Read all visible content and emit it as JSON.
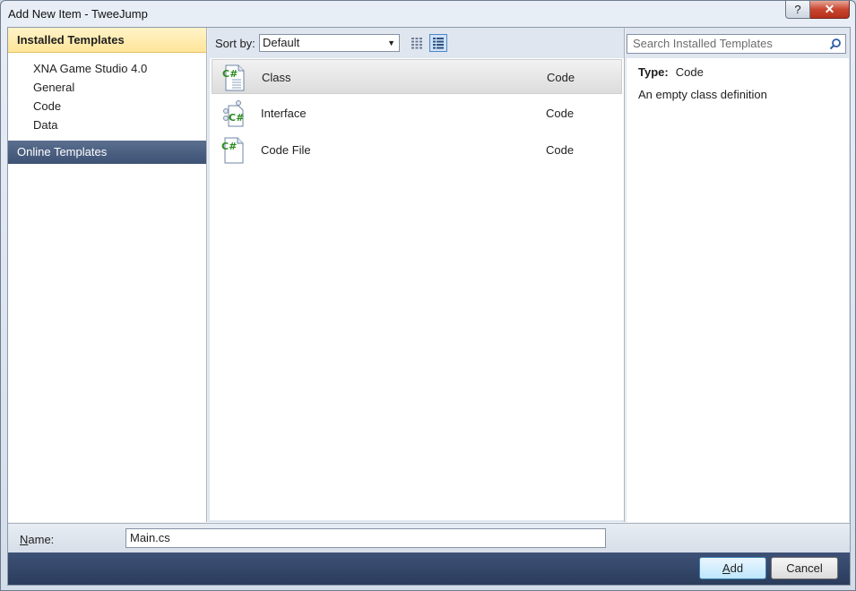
{
  "window": {
    "title": "Add New Item - TweeJump",
    "help_label": "?",
    "close_label": "✕"
  },
  "left": {
    "installed_header": "Installed Templates",
    "categories": [
      {
        "label": "XNA Game Studio 4.0"
      },
      {
        "label": "General"
      },
      {
        "label": "Code"
      },
      {
        "label": "Data"
      }
    ],
    "online_label": "Online Templates"
  },
  "toolbar": {
    "sort_label": "Sort by:",
    "sort_value": "Default",
    "views": [
      "small-icons-view-icon",
      "list-view-icon"
    ],
    "selected_view": "list-view-icon"
  },
  "templates": [
    {
      "name": "Class",
      "type": "Code",
      "icon": "csharp-class-icon",
      "selected": true
    },
    {
      "name": "Interface",
      "type": "Code",
      "icon": "csharp-interface-icon",
      "selected": false
    },
    {
      "name": "Code File",
      "type": "Code",
      "icon": "csharp-code-file-icon",
      "selected": false
    }
  ],
  "search": {
    "placeholder": "Search Installed Templates"
  },
  "details": {
    "type_label": "Type:",
    "type_value": "Code",
    "description": "An empty class definition"
  },
  "name_field": {
    "label_prefix": "N",
    "label_rest": "ame:",
    "value": "Main.cs"
  },
  "buttons": {
    "add_prefix": "A",
    "add_rest": "dd",
    "cancel": "Cancel"
  },
  "colors": {
    "accent_selected": "#ffe59a",
    "footer": "#2b3c5c",
    "csharp_green": "#2a8a1c"
  }
}
